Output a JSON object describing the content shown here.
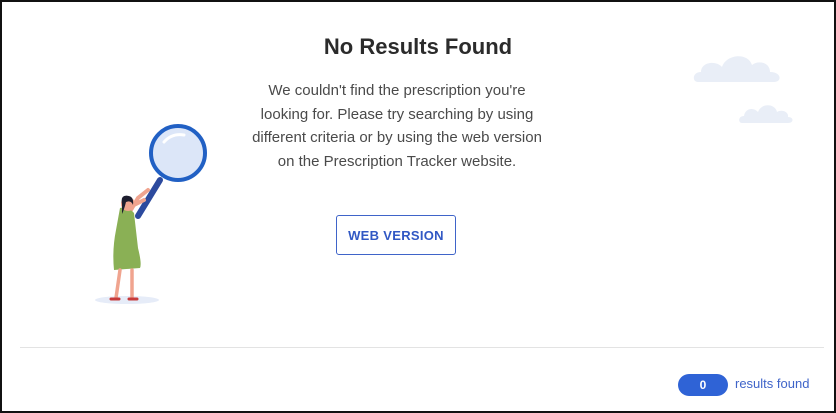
{
  "empty_state": {
    "title": "No Results Found",
    "message": "We couldn't find the prescription you're looking for. Please try searching by using different criteria or by using the web version on the Prescription Tracker website.",
    "web_version_label": "WEB VERSION",
    "illustration": "woman-with-magnifying-glass-icon"
  },
  "footer": {
    "results_count": "0",
    "results_label": "results found"
  },
  "colors": {
    "accent": "#2f63d6",
    "button_border": "#3f64c9",
    "cloud": "#e9eef7"
  }
}
